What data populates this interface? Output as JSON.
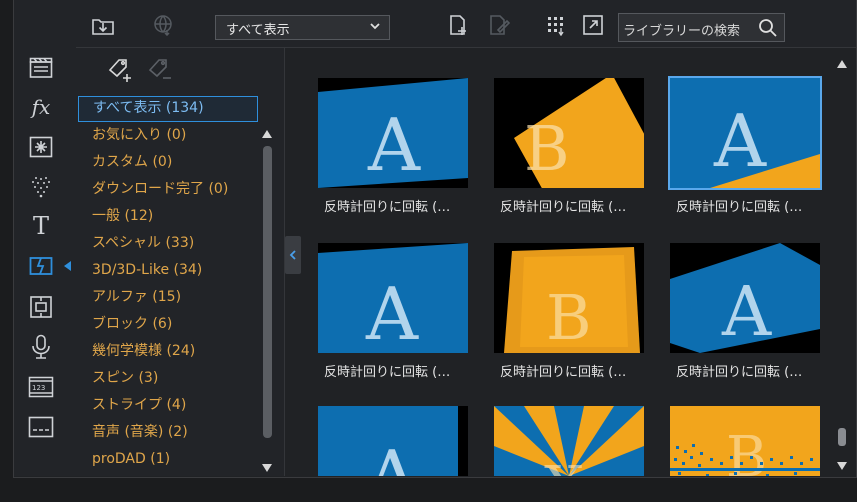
{
  "toolbar": {
    "filter_selected": "すべて表示",
    "search_placeholder": "ライブラリーの検索"
  },
  "rail": {
    "items": [
      "media-icon",
      "fx-icon",
      "particle-icon",
      "sparkle-icon",
      "title-icon",
      "transition-icon",
      "pip-icon",
      "microphone-icon",
      "chapter-icon",
      "subtitle-icon"
    ],
    "active": "transition-icon"
  },
  "categories": [
    {
      "label": "すべて表示 (134)",
      "selected": true
    },
    {
      "label": "お気に入り (0)"
    },
    {
      "label": "カスタム (0)"
    },
    {
      "label": "ダウンロード完了 (0)"
    },
    {
      "label": "一般 (12)"
    },
    {
      "label": "スペシャル (33)"
    },
    {
      "label": "3D/3D-Like (34)"
    },
    {
      "label": "アルファ (15)"
    },
    {
      "label": "ブロック (6)"
    },
    {
      "label": "幾何学模様 (24)"
    },
    {
      "label": "スピン (3)"
    },
    {
      "label": "ストライプ (4)"
    },
    {
      "label": "音声 (音楽) (2)"
    },
    {
      "label": "proDAD (1)"
    }
  ],
  "items": [
    {
      "caption": "反時計回りに回転 (…"
    },
    {
      "caption": "反時計回りに回転 (…"
    },
    {
      "caption": "反時計回りに回転 (…",
      "selected": true
    },
    {
      "caption": "反時計回りに回転 (…"
    },
    {
      "caption": "反時計回りに回転 (…"
    },
    {
      "caption": "反時計回りに回転 (…"
    }
  ],
  "colors": {
    "accent": "#2f8fdc",
    "category_text": "#e0a64a",
    "tile_blue": "#0d6eb0",
    "tile_orange": "#f2a51c"
  }
}
